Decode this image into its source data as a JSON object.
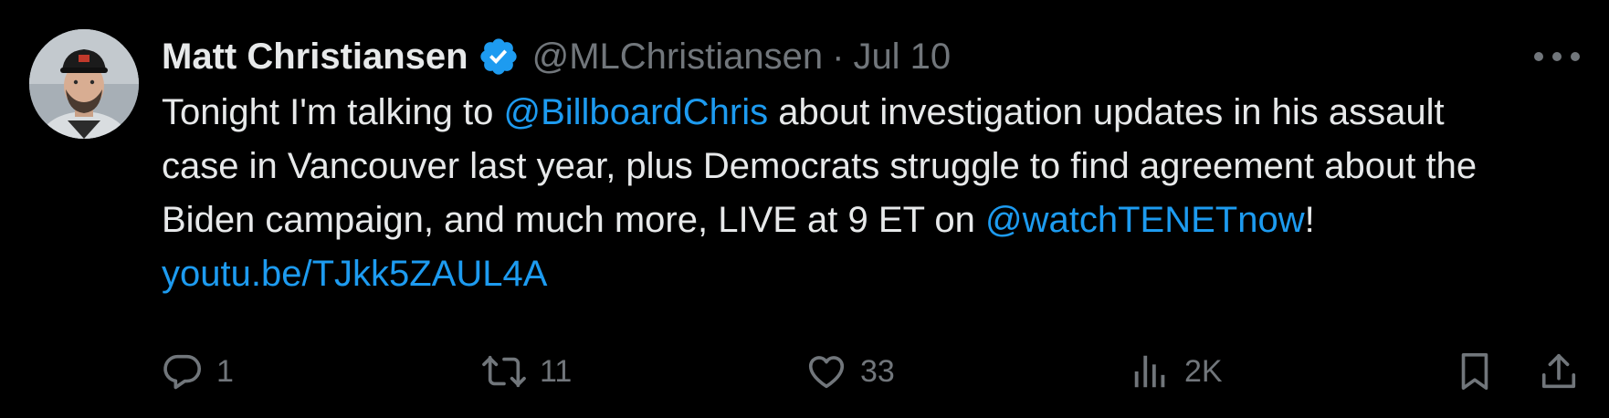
{
  "tweet": {
    "author": {
      "name": "Matt Christiansen",
      "handle": "@MLChristiansen",
      "separator": "·",
      "date": "Jul 10",
      "verified": true
    },
    "text": {
      "part1": "Tonight I'm talking to ",
      "mention1": "@BillboardChris",
      "part2": " about investigation updates in his assault case in Vancouver last year, plus Democrats struggle to find agreement about the Biden campaign, and much more, LIVE at 9 ET on ",
      "mention2": "@watchTENETnow",
      "part3": "! ",
      "link": "youtu.be/TJkk5ZAUL4A"
    },
    "actions": {
      "replies": "1",
      "retweets": "11",
      "likes": "33",
      "views": "2K"
    }
  },
  "colors": {
    "background": "#000000",
    "text": "#e7e9ea",
    "secondary": "#71767b",
    "accent": "#1d9bf0"
  },
  "icons": {
    "more": "more-horizontal-icon",
    "verified": "verified-badge-icon",
    "reply": "reply-icon",
    "retweet": "retweet-icon",
    "like": "heart-icon",
    "views": "views-chart-icon",
    "bookmark": "bookmark-icon",
    "share": "share-icon"
  }
}
